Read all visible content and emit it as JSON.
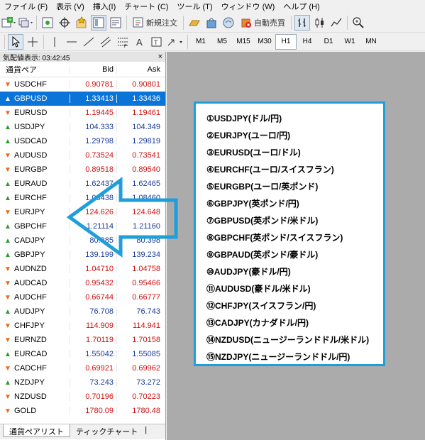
{
  "menu": [
    "ファイル (F)",
    "表示 (V)",
    "挿入(I)",
    "チャート (C)",
    "ツール (T)",
    "ウィンドウ (W)",
    "ヘルプ (H)"
  ],
  "toolbar": {
    "new_order": "新規注文",
    "auto_trade": "自動売買",
    "timeframes": [
      "M1",
      "M5",
      "M15",
      "M30",
      "H1",
      "H4",
      "D1",
      "W1",
      "MN"
    ],
    "active_timeframe": "H1"
  },
  "market_watch": {
    "title": "気配値表示: 03:42:45",
    "close": "×",
    "headers": {
      "symbol": "通貨ペア",
      "bid": "Bid",
      "ask": "Ask"
    },
    "rows": [
      {
        "symbol": "USDCHF",
        "bid": "0.90781",
        "ask": "0.90801",
        "dir": "down"
      },
      {
        "symbol": "GBPUSD",
        "bid": "1.33413",
        "ask": "1.33436",
        "dir": "up",
        "selected": true
      },
      {
        "symbol": "EURUSD",
        "bid": "1.19445",
        "ask": "1.19461",
        "dir": "down"
      },
      {
        "symbol": "USDJPY",
        "bid": "104.333",
        "ask": "104.349",
        "dir": "up"
      },
      {
        "symbol": "USDCAD",
        "bid": "1.29798",
        "ask": "1.29819",
        "dir": "up"
      },
      {
        "symbol": "AUDUSD",
        "bid": "0.73524",
        "ask": "0.73541",
        "dir": "down"
      },
      {
        "symbol": "EURGBP",
        "bid": "0.89518",
        "ask": "0.89540",
        "dir": "down"
      },
      {
        "symbol": "EURAUD",
        "bid": "1.62437",
        "ask": "1.62465",
        "dir": "up"
      },
      {
        "symbol": "EURCHF",
        "bid": "1.08438",
        "ask": "1.08460",
        "dir": "up"
      },
      {
        "symbol": "EURJPY",
        "bid": "124.626",
        "ask": "124.648",
        "dir": "down"
      },
      {
        "symbol": "GBPCHF",
        "bid": "1.21114",
        "ask": "1.21160",
        "dir": "up"
      },
      {
        "symbol": "CADJPY",
        "bid": "80.385",
        "ask": "80.398",
        "dir": "up"
      },
      {
        "symbol": "GBPJPY",
        "bid": "139.199",
        "ask": "139.234",
        "dir": "up"
      },
      {
        "symbol": "AUDNZD",
        "bid": "1.04710",
        "ask": "1.04758",
        "dir": "down"
      },
      {
        "symbol": "AUDCAD",
        "bid": "0.95432",
        "ask": "0.95466",
        "dir": "down"
      },
      {
        "symbol": "AUDCHF",
        "bid": "0.66744",
        "ask": "0.66777",
        "dir": "down"
      },
      {
        "symbol": "AUDJPY",
        "bid": "76.708",
        "ask": "76.743",
        "dir": "up"
      },
      {
        "symbol": "CHFJPY",
        "bid": "114.909",
        "ask": "114.941",
        "dir": "down"
      },
      {
        "symbol": "EURNZD",
        "bid": "1.70119",
        "ask": "1.70158",
        "dir": "down"
      },
      {
        "symbol": "EURCAD",
        "bid": "1.55042",
        "ask": "1.55085",
        "dir": "up"
      },
      {
        "symbol": "CADCHF",
        "bid": "0.69921",
        "ask": "0.69962",
        "dir": "down"
      },
      {
        "symbol": "NZDJPY",
        "bid": "73.243",
        "ask": "73.272",
        "dir": "up"
      },
      {
        "symbol": "NZDUSD",
        "bid": "0.70196",
        "ask": "0.70223",
        "dir": "down"
      },
      {
        "symbol": "GOLD",
        "bid": "1780.09",
        "ask": "1780.48",
        "dir": "down"
      }
    ],
    "tabs": [
      "通貨ペアリスト",
      "ティックチャート"
    ],
    "tab_separator": "|"
  },
  "annotation": {
    "border_color": "#1f9ed9",
    "lines": [
      "①USDJPY(ドル/円)",
      "②EURJPY(ユーロ/円)",
      "③EURUSD(ユーロ/ドル)",
      "④EURCHF(ユーロ/スイスフラン)",
      "⑤EURGBP(ユーロ/英ポンド)",
      "⑥GBPJPY(英ポンド/円)",
      "⑦GBPUSD(英ポンド/米ドル)",
      "⑧GBPCHF(英ポンド/スイスフラン)",
      "⑨GBPAUD(英ポンド/豪ドル)",
      "⑩AUDJPY(豪ドル/円)",
      "⑪AUDUSD(豪ドル/米ドル)",
      "⑫CHFJPY(スイスフラン/円)",
      "⑬CADJPY(カナダドル/円)",
      "⑭NZDUSD(ニュージーランドドル/米ドル)",
      "⑮NZDJPY(ニュージーランドドル/円)"
    ]
  },
  "colors": {
    "selection": "#0a74d8",
    "up_arrow": "#2e9a2e",
    "down_arrow": "#e86a1a",
    "price_down": "#d01010",
    "price_up": "#1a3a9a",
    "chart_background": "#ababab"
  }
}
